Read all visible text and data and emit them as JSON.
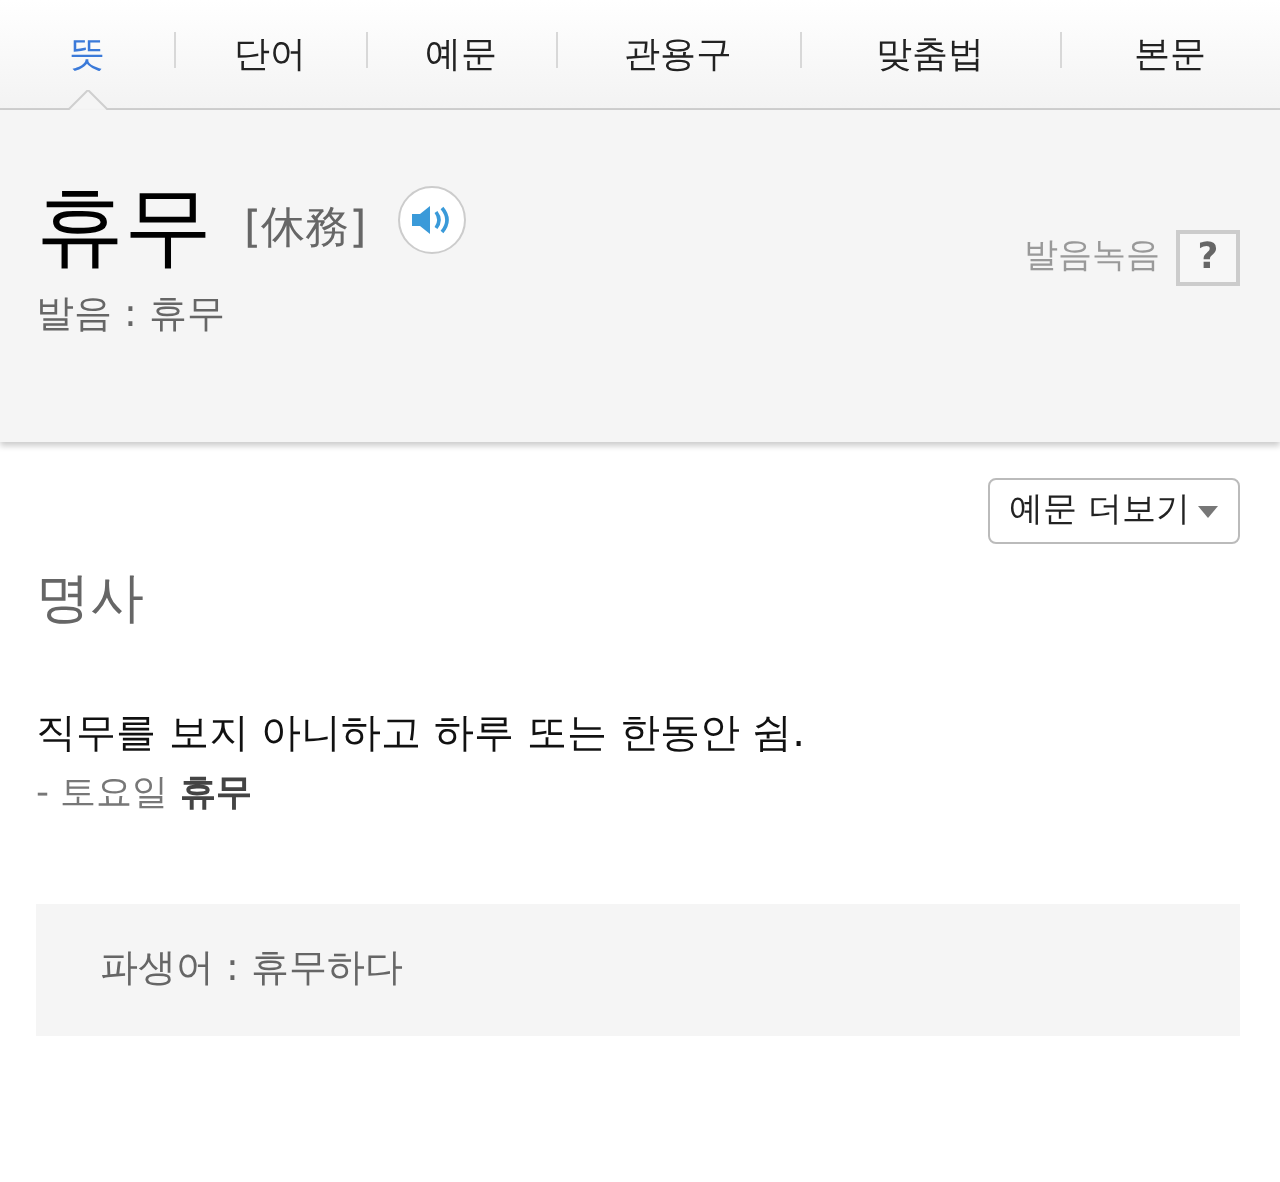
{
  "tabs": [
    {
      "label": "뜻",
      "selected": true
    },
    {
      "label": "단어",
      "selected": false
    },
    {
      "label": "예문",
      "selected": false
    },
    {
      "label": "관용구",
      "selected": false
    },
    {
      "label": "맞춤법",
      "selected": false
    },
    {
      "label": "본문",
      "selected": false
    }
  ],
  "entry": {
    "headword": "휴무",
    "hanja": "[休務]",
    "pronunciation": "발음 : 휴무",
    "recording_label": "발음녹음",
    "help": "?"
  },
  "more_examples_button": "예문 더보기",
  "part_of_speech": "명사",
  "definition": "직무를 보지 아니하고 하루 또는 한동안 쉼.",
  "examples": [
    "- 토요일 **휴무**"
  ],
  "derived": "파생어 : 휴무하다"
}
